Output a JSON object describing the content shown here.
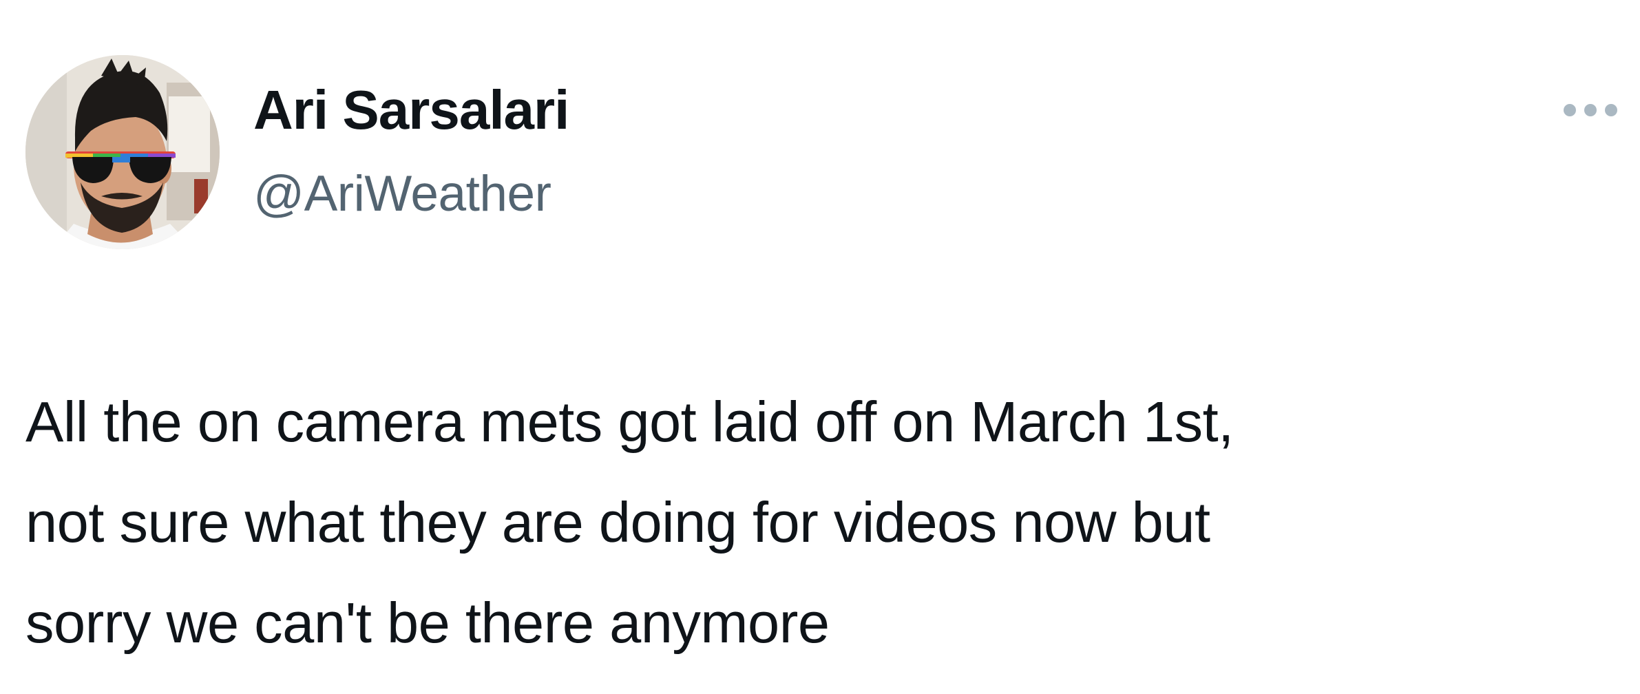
{
  "author": {
    "display_name": "Ari Sarsalari",
    "handle": "@AriWeather",
    "avatar_icon": "profile-photo"
  },
  "header": {
    "more_icon": "more-horizontal-icon"
  },
  "tweet": {
    "lines": [
      "All the on camera mets got laid off on March 1st,",
      "not sure what they are doing for videos now but",
      "sorry we can't be there anymore"
    ]
  },
  "colors": {
    "text_primary": "#0f1419",
    "text_secondary": "#536471",
    "icon_muted": "#aab8c2",
    "background": "#ffffff"
  }
}
